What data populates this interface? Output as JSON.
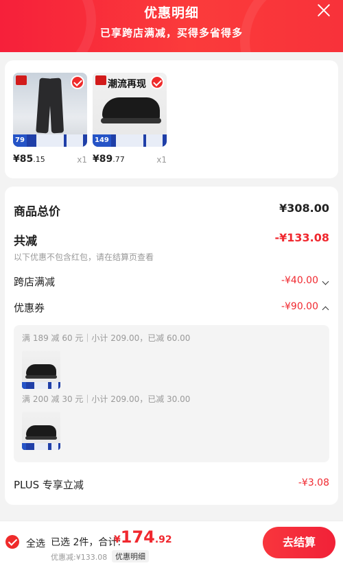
{
  "header": {
    "title": "优惠明细",
    "subtitle": "已享跨店满减，买得多省得多"
  },
  "products": [
    {
      "name": "pants",
      "promo_price": "79",
      "price_int": "¥85",
      "price_dec": ".15",
      "qty": "x1"
    },
    {
      "name": "shoes",
      "promo_price": "149",
      "banner_text": "潮流再现",
      "price_int": "¥89",
      "price_dec": ".77",
      "qty": "x1"
    }
  ],
  "summary": {
    "total_label": "商品总价",
    "total_value": "¥308.00",
    "discount_label": "共减",
    "discount_value": "-¥133.08",
    "discount_note": "以下优惠不包含红包，请在结算页查看",
    "cross_store_label": "跨店满减",
    "cross_store_value": "-¥40.00",
    "coupon_label": "优惠券",
    "coupon_value": "-¥90.00",
    "coupons": [
      {
        "text": "满 189 减 60 元｜小计 209.00，已减 60.00"
      },
      {
        "text": "满 200 减 30 元｜小计 209.00，已减 30.00"
      }
    ],
    "plus_label": "PLUS 专享立减",
    "plus_value": "-¥3.08"
  },
  "footer": {
    "select_all": "全选",
    "selected": "已选 2件，合计:",
    "total_symbol": "¥",
    "total_int": "174",
    "total_dec": ".92",
    "saved": "优惠减:¥133.08",
    "detail_label": "优惠明细",
    "pay_label": "去结算"
  },
  "colors": {
    "accent": "#f0282f",
    "header": "#f8323a"
  }
}
